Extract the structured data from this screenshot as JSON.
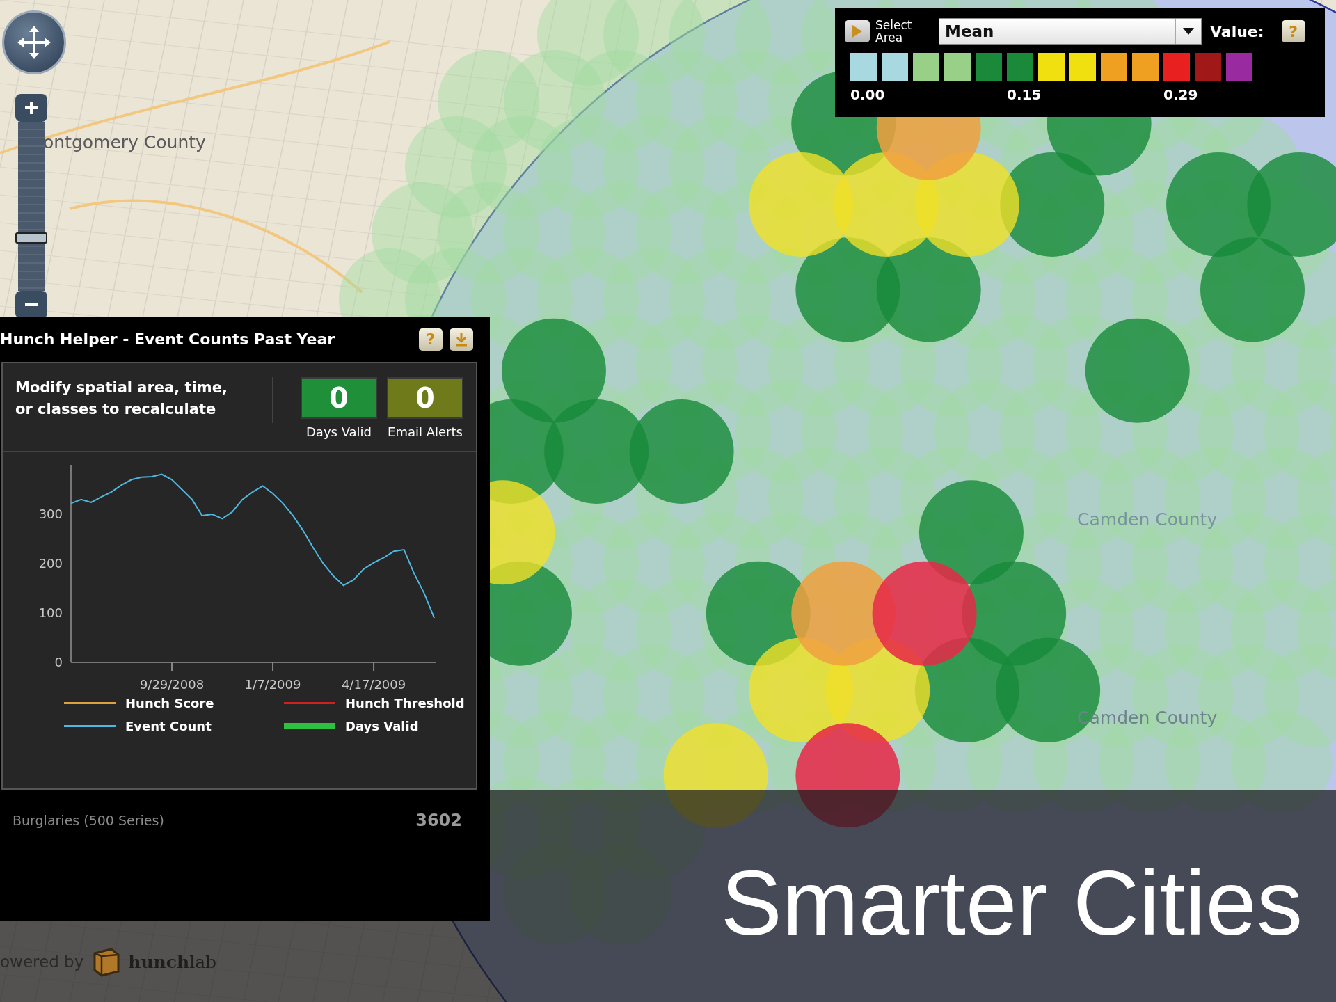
{
  "zoom": {
    "level": 0.28
  },
  "map": {
    "labels": [
      {
        "text": "ontgomery County"
      },
      {
        "text": "Camden County"
      },
      {
        "text": "Camden County"
      }
    ]
  },
  "legend": {
    "select_button": "Select Area",
    "statistic": "Mean",
    "value_label": "Value:",
    "help_glyph": "?",
    "swatches": [
      {
        "color": "#a8d8e0"
      },
      {
        "color": "#a8d8e0"
      },
      {
        "color": "#98d088"
      },
      {
        "color": "#98d088"
      },
      {
        "color": "#1a8a3a"
      },
      {
        "color": "#1a8a3a"
      },
      {
        "color": "#f0e010"
      },
      {
        "color": "#f0e010"
      },
      {
        "color": "#f0a020"
      },
      {
        "color": "#f0a020"
      },
      {
        "color": "#e82020"
      },
      {
        "color": "#a01818"
      },
      {
        "color": "#9a2aa0"
      }
    ],
    "ticks": [
      "0.00",
      "0.15",
      "0.29"
    ]
  },
  "panel": {
    "title": "Hunch Helper - Event Counts Past Year",
    "help_glyph": "?",
    "message": "Modify spatial area, time, or classes to recalculate",
    "counters": [
      {
        "value": "0",
        "label": "Days Valid",
        "color": "#1f8f3a"
      },
      {
        "value": "0",
        "label": "Email Alerts",
        "color": "#6f7a1a"
      }
    ],
    "chart_data": {
      "type": "line",
      "categories": [
        null,
        null,
        null,
        null,
        null,
        null,
        null,
        null,
        null,
        null,
        "9/29/2008",
        null,
        null,
        null,
        null,
        null,
        null,
        null,
        null,
        null,
        "1/7/2009",
        null,
        null,
        null,
        null,
        null,
        null,
        null,
        null,
        null,
        "4/17/2009",
        null,
        null,
        null,
        null,
        null,
        null
      ],
      "series": [
        {
          "name": "Event Count",
          "color": "#4fb8e0",
          "values": [
            322,
            330,
            324,
            335,
            345,
            359,
            370,
            375,
            376,
            381,
            370,
            350,
            330,
            297,
            300,
            291,
            305,
            330,
            345,
            357,
            342,
            322,
            297,
            267,
            232,
            200,
            175,
            156,
            167,
            189,
            202,
            212,
            225,
            228,
            180,
            140,
            90
          ]
        }
      ],
      "ylim": [
        0,
        400
      ],
      "yticks": [
        0,
        100,
        200,
        300
      ]
    },
    "chart_legend": [
      {
        "name": "Hunch Score",
        "color": "#e0a040",
        "kind": "line"
      },
      {
        "name": "Hunch Threshold",
        "color": "#d02020",
        "kind": "line"
      },
      {
        "kind": "series"
      },
      {
        "name": "Days Valid",
        "color": "#30c040",
        "kind": "band"
      }
    ],
    "class_row": {
      "name": "Burglaries (500 Series)",
      "count": "3602"
    }
  },
  "powered_by": {
    "prefix": "owered by",
    "brand": "**hunch**lab"
  },
  "caption": "Smarter Cities"
}
